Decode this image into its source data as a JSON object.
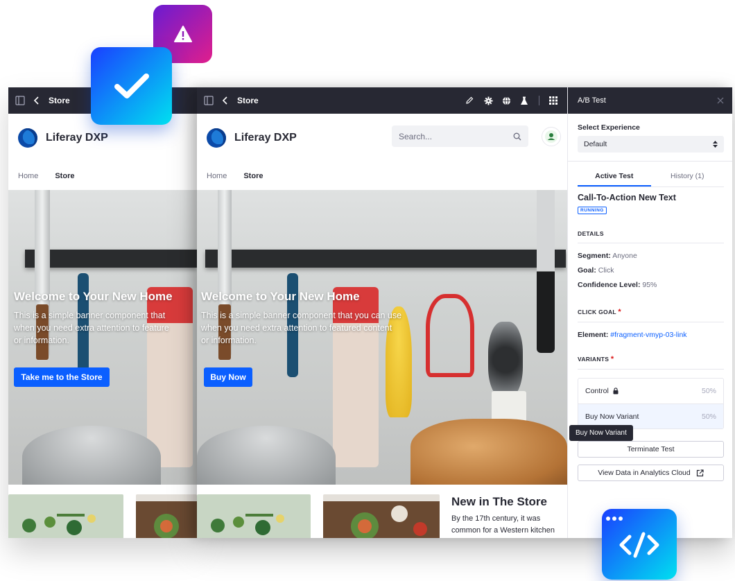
{
  "left_window": {
    "topbar": {
      "title": "Store"
    },
    "brand": {
      "name": "Liferay DXP"
    },
    "nav": [
      "Home",
      "Store"
    ],
    "hero": {
      "title": "Welcome to Your New Home",
      "text_lines": [
        "This is a simple banner component that",
        "when you need extra attention to feature",
        "or information."
      ],
      "button": "Take me to the Store"
    }
  },
  "right_window": {
    "topbar": {
      "title": "Store",
      "icons": [
        "pencil-icon",
        "gear-icon",
        "globe-icon",
        "flask-icon",
        "apps-grid-icon"
      ]
    },
    "brand": {
      "name": "Liferay DXP"
    },
    "search": {
      "placeholder": "Search..."
    },
    "nav": [
      "Home",
      "Store"
    ],
    "hero": {
      "title": "Welcome to Your New Home",
      "text_lines": [
        "This is a simple banner component that you can use",
        "when you need extra attention to featured content",
        "or information."
      ],
      "button": "Buy Now"
    },
    "store": {
      "heading": "New in The Store",
      "text_lines": [
        "By the 17th century, it was",
        "common for a Western kitchen"
      ]
    }
  },
  "panel": {
    "title": "A/B Test",
    "select_experience_label": "Select Experience",
    "select_experience_value": "Default",
    "tabs": [
      "Active Test",
      "History (1)"
    ],
    "test_title": "Call-To-Action New Text",
    "status": "RUNNING",
    "details_caption": "DETAILS",
    "details": [
      {
        "key": "Segment:",
        "value": "Anyone"
      },
      {
        "key": "Goal:",
        "value": "Click"
      },
      {
        "key": "Confidence Level:",
        "value": "95%"
      }
    ],
    "click_goal_caption": "CLICK GOAL",
    "required_mark": "*",
    "element_key": "Element:",
    "element_value": "#fragment-vmyp-03-link",
    "variants_caption": "VARIANTS",
    "variants": [
      {
        "name": "Control",
        "pct": "50%",
        "locked": true
      },
      {
        "name": "Buy Now Variant",
        "pct": "50%",
        "locked": false
      }
    ],
    "tooltip": "Buy Now Variant",
    "terminate_button": "Terminate Test",
    "view_data_button": "View Data in Analytics Cloud"
  },
  "badges": [
    "check-icon",
    "warning-icon",
    "code-icon"
  ],
  "colors": {
    "topbar": "#272833",
    "primary": "#0b5fff",
    "warning_badge": [
      "#6a1bd1",
      "#e01e8c"
    ],
    "check_badge": [
      "#1a3fff",
      "#00e0f0"
    ],
    "code_badge": [
      "#1a3fff",
      "#00e0f0"
    ]
  }
}
